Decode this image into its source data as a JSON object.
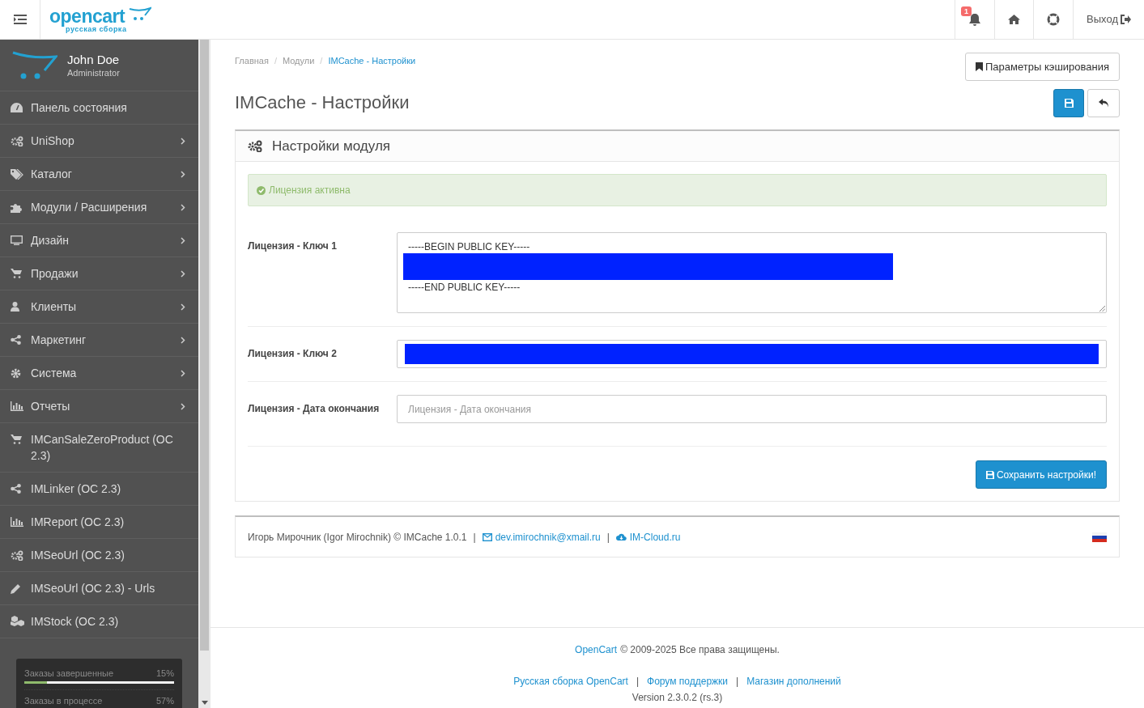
{
  "header": {
    "logo": {
      "word": "opencart",
      "subtitle": "русская сборка"
    },
    "notifications": {
      "count": "1"
    },
    "logout": "Выход"
  },
  "sidebar": {
    "profile": {
      "name": "John Doe",
      "role": "Administrator"
    },
    "items": [
      {
        "label": "Панель состояния",
        "has_submenu": false
      },
      {
        "label": "UniShop",
        "has_submenu": true
      },
      {
        "label": "Каталог",
        "has_submenu": true
      },
      {
        "label": "Модули / Расширения",
        "has_submenu": true
      },
      {
        "label": "Дизайн",
        "has_submenu": true
      },
      {
        "label": "Продажи",
        "has_submenu": true
      },
      {
        "label": "Клиенты",
        "has_submenu": true
      },
      {
        "label": "Маркетинг",
        "has_submenu": true
      },
      {
        "label": "Система",
        "has_submenu": true
      },
      {
        "label": "Отчеты",
        "has_submenu": true
      },
      {
        "label": "IMCanSaleZeroProduct (OC 2.3)",
        "has_submenu": false
      },
      {
        "label": "IMLinker (OC 2.3)",
        "has_submenu": false
      },
      {
        "label": "IMReport (OC 2.3)",
        "has_submenu": false
      },
      {
        "label": "IMSeoUrl (OC 2.3)",
        "has_submenu": false
      },
      {
        "label": "IMSeoUrl (OC 2.3) - Urls",
        "has_submenu": false
      },
      {
        "label": "IMStock (OC 2.3)",
        "has_submenu": false
      }
    ],
    "stats": [
      {
        "label": "Заказы завершенные",
        "value": "15%",
        "level": 0.15
      },
      {
        "label": "Заказы в процессе",
        "value": "57%"
      }
    ]
  },
  "breadcrumb_separator": "/",
  "breadcrumbs": [
    {
      "label": "Главная",
      "selected": false
    },
    {
      "label": "Модули",
      "selected": false
    },
    {
      "label": "IMCache - Настройки",
      "selected": true
    }
  ],
  "page_title": "IMCache - Настройки",
  "cache_button": "Параметры кэширования",
  "panel": {
    "title": "Настройки модуля",
    "alert": "Лицензия активна",
    "fields": [
      {
        "label": "Лицензия - Ключ 1",
        "kind": "textarea",
        "lines": [
          "-----BEGIN PUBLIC KEY-----",
          "-----END PUBLIC KEY-----"
        ],
        "redacted": true
      },
      {
        "label": "Лицензия - Ключ 2",
        "kind": "input",
        "redacted": true
      },
      {
        "label": "Лицензия - Дата окончания",
        "kind": "input",
        "placeholder": "Лицензия - Дата окончания",
        "redacted": false
      }
    ],
    "save_button": "Сохранить настройки!"
  },
  "module_footer": {
    "author": "Игорь Мирочник (Igor Mirochnik) © IMCache 1.0.1",
    "separator": "|",
    "email": "dev.imirochnik@xmail.ru",
    "site": "IM-Cloud.ru"
  },
  "page_footer": {
    "brand": "OpenCart",
    "copyright": "© 2009-2025 Все права защищены.",
    "links": [
      "Русская сборка OpenCart",
      "Форум поддержки",
      "Магазин дополнений"
    ],
    "separator": "|",
    "version": "Version 2.3.0.2 (rs.3)"
  }
}
